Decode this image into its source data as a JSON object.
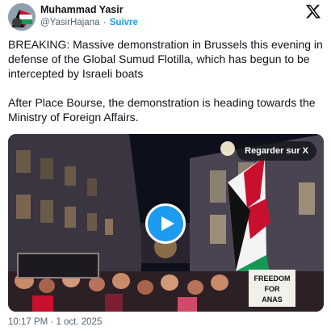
{
  "author": {
    "display_name": "Muhammad Yasir",
    "handle": "@YasirHajana",
    "separator": "·",
    "follow_label": "Suivre"
  },
  "tweet": {
    "paragraphs": [
      "BREAKING: Massive demonstration in Brussels this evening in defense of the Global Sumud Flotilla, which has begun to be intercepted by Israeli boats",
      "After Place Bourse, the demonstration is heading towards the Ministry of Foreign Affairs."
    ]
  },
  "media": {
    "watch_label": "Regarder sur X",
    "sign_text": [
      "FREEDOM",
      "FOR",
      "ANAS"
    ],
    "icons": {
      "play": "play-icon",
      "brand": "x-logo-icon"
    }
  },
  "timestamp": "10:17 PM · 1 oct. 2025",
  "colors": {
    "accent": "#1d9bf0",
    "text": "#0f1419",
    "muted": "#536471"
  }
}
